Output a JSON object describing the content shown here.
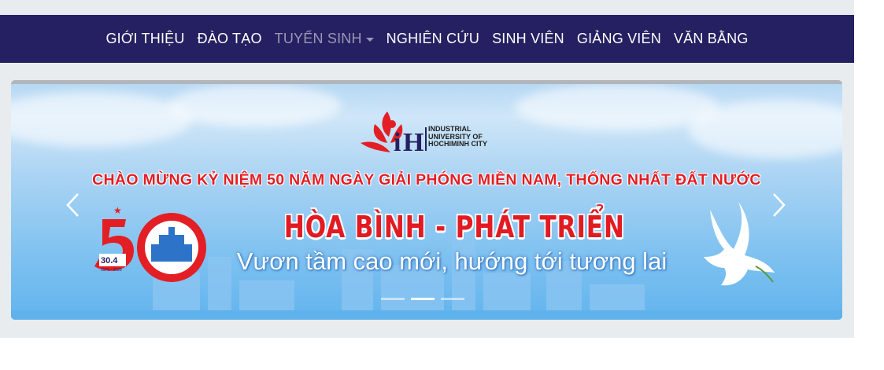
{
  "nav": {
    "items": [
      {
        "label": "GIỚI THIỆU",
        "active": false
      },
      {
        "label": "ĐÀO TẠO",
        "active": false
      },
      {
        "label": "TUYỂN SINH",
        "active": true,
        "dropdown": true
      },
      {
        "label": "NGHIÊN CỨU",
        "active": false
      },
      {
        "label": "SINH VIÊN",
        "active": false
      },
      {
        "label": "GIẢNG VIÊN",
        "active": false
      },
      {
        "label": "VĂN BẰNG",
        "active": false
      }
    ],
    "background": "#252061",
    "active_color": "#9a98b4"
  },
  "banner": {
    "logo": {
      "line1": "INDUSTRIAL",
      "line2": "UNIVERSITY OF",
      "line3": "HOCHIMINH CITY"
    },
    "headline": "CHÀO MỪNG KỶ NIỆM 50 NĂM NGÀY GIẢI PHÓNG MIỀN NAM, THỐNG NHẤT ĐẤT NƯỚC",
    "slogan": "HÒA BÌNH - PHÁT TRIỂN",
    "tagline": "Vươn tầm cao mới, hướng tới tương lai",
    "emblem": {
      "date": "30.4",
      "years": "1975 - 2025"
    },
    "accent": "#e31e24"
  },
  "carousel": {
    "slide_count": 3,
    "active_index": 1,
    "prev_icon": "chevron-left-icon",
    "next_icon": "chevron-right-icon"
  }
}
